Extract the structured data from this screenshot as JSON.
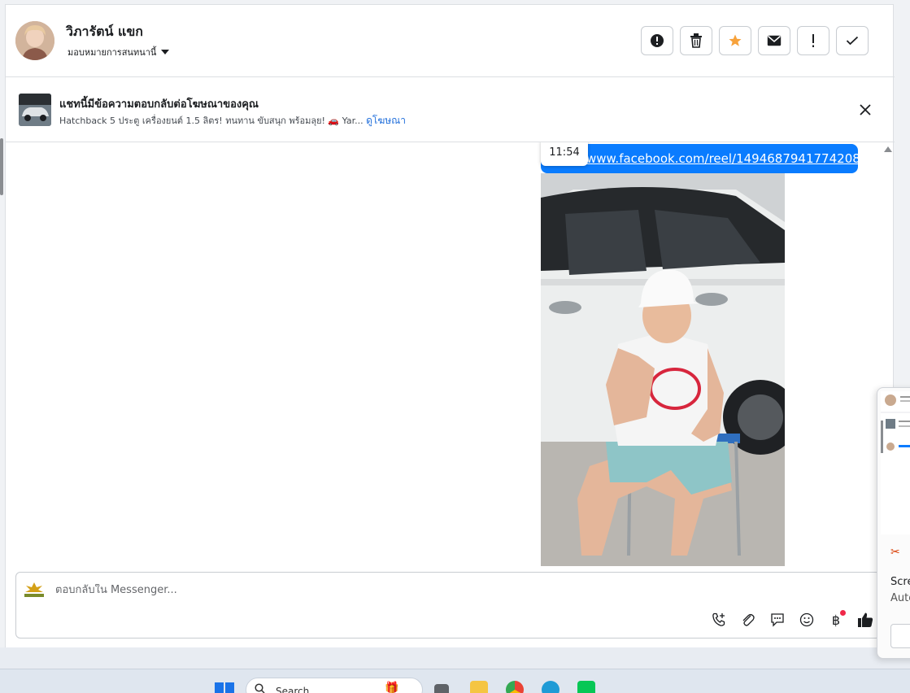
{
  "header": {
    "contact_name": "วิภารัตน์ แขก",
    "assign_label": "มอบหมายการสนทนานี้",
    "actions": [
      {
        "name": "report-icon",
        "glyph": "❗"
      },
      {
        "name": "trash-icon",
        "glyph": "🗑"
      },
      {
        "name": "star-icon",
        "glyph": "★"
      },
      {
        "name": "envelope-icon",
        "glyph": "✉"
      },
      {
        "name": "exclamation-icon",
        "glyph": "!"
      },
      {
        "name": "check-icon",
        "glyph": "✓"
      }
    ]
  },
  "ad": {
    "title": "แชทนี้มีข้อความตอบกลับต่อโฆษณาของคุณ",
    "description": "Hatchback 5 ประตู เครื่องยนต์ 1.5 ลิตร! ทนทาน ขับสนุก พร้อมลุย! 🚗 Yar...",
    "view_link": "ดูโฆษณา"
  },
  "messages": {
    "time": "11:54",
    "link_text": "www.facebook.com/reel/1494687941774208"
  },
  "composer": {
    "placeholder": "ตอบกลับใน Messenger..."
  },
  "taskbar": {
    "search_label": "Search"
  },
  "popup": {
    "title": "Scre",
    "subtitle": "Auto"
  },
  "colors": {
    "accent": "#0a7cff",
    "star": "#f7a23b",
    "link": "#216fdb"
  }
}
